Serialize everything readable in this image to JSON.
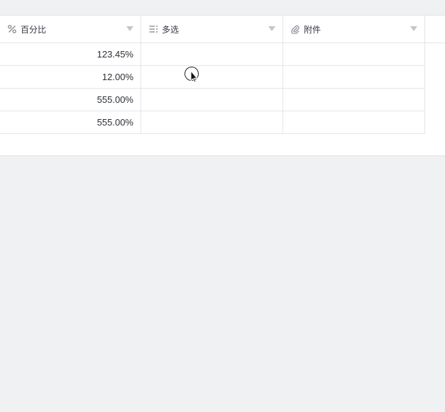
{
  "header": {
    "columns": [
      {
        "label": "百分比",
        "icon": "percent-icon"
      },
      {
        "label": "多选",
        "icon": "multi-select-icon"
      },
      {
        "label": "附件",
        "icon": "attachment-icon"
      }
    ]
  },
  "rows": [
    {
      "percent": "123.45%",
      "multi": "",
      "attachment": ""
    },
    {
      "percent": "12.00%",
      "multi": "",
      "attachment": ""
    },
    {
      "percent": "555.00%",
      "multi": "",
      "attachment": ""
    },
    {
      "percent": "555.00%",
      "multi": "",
      "attachment": ""
    }
  ],
  "colors": {
    "border": "#e3e5e8",
    "background": "#f0f1f3",
    "icon": "#8c9098",
    "caret": "#c3c6cc"
  }
}
